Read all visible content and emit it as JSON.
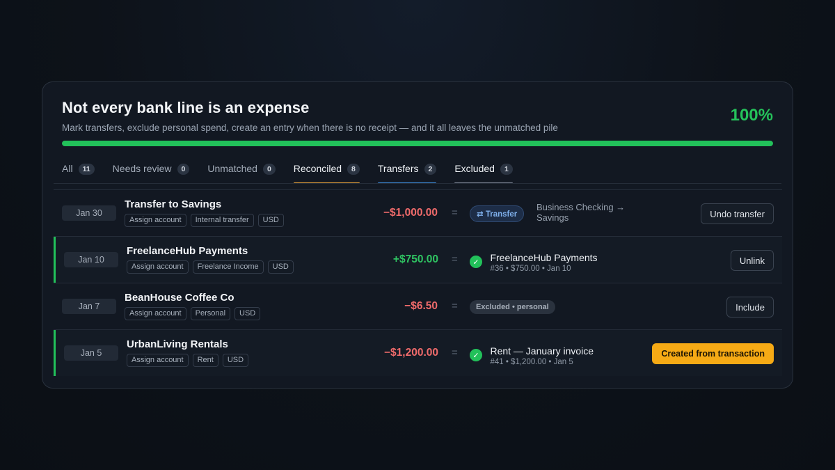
{
  "header": {
    "title": "Not every bank line is an expense",
    "subtitle": "Mark transfers, exclude personal spend, create an entry when there is no receipt — and it all leaves the unmatched pile",
    "percent_label": "100%",
    "progress": 1.0,
    "progress_color": "#22c15a"
  },
  "tabs": [
    {
      "label": "All",
      "count": "11",
      "active": false
    },
    {
      "label": "Needs review",
      "count": "0",
      "active": false
    },
    {
      "label": "Unmatched",
      "count": "0",
      "active": false
    },
    {
      "label": "Reconciled",
      "count": "8",
      "active": true,
      "underline_color": "#e8a33a"
    },
    {
      "label": "Transfers",
      "count": "2",
      "active": true,
      "underline_color": "#3d8bd9"
    },
    {
      "label": "Excluded",
      "count": "1",
      "active": true,
      "underline_color": "#7c8594"
    }
  ],
  "rows": [
    {
      "date": "Jan 30",
      "name": "Transfer to Savings",
      "chips": [
        "Assign account",
        "Internal transfer",
        "USD"
      ],
      "amount": "−$1,000.00",
      "equals": "=",
      "badge": "⇄ Transfer",
      "note": "Business Checking → Savings",
      "action": "Undo transfer"
    },
    {
      "date": "Jan 10",
      "name": "FreelanceHub Payments",
      "chips": [
        "Assign account",
        "Freelance Income",
        "USD"
      ],
      "amount": "+$750.00",
      "equals": "=",
      "check": "✓",
      "match_title": "FreelanceHub Payments",
      "match_sub": "#36 • $750.00 • Jan 10",
      "action": "Unlink"
    },
    {
      "date": "Jan 7",
      "name": "BeanHouse Coffee Co",
      "chips": [
        "Assign account",
        "Personal",
        "USD"
      ],
      "amount": "−$6.50",
      "equals": "=",
      "badge": "Excluded • personal",
      "action": "Include"
    },
    {
      "date": "Jan 5",
      "name": "UrbanLiving Rentals",
      "chips": [
        "Assign account",
        "Rent",
        "USD"
      ],
      "amount": "−$1,200.00",
      "equals": "=",
      "check": "✓",
      "match_title": "Rent — January invoice",
      "match_sub": "#41 • $1,200.00 • Jan 5",
      "action": "Created from transaction"
    }
  ]
}
